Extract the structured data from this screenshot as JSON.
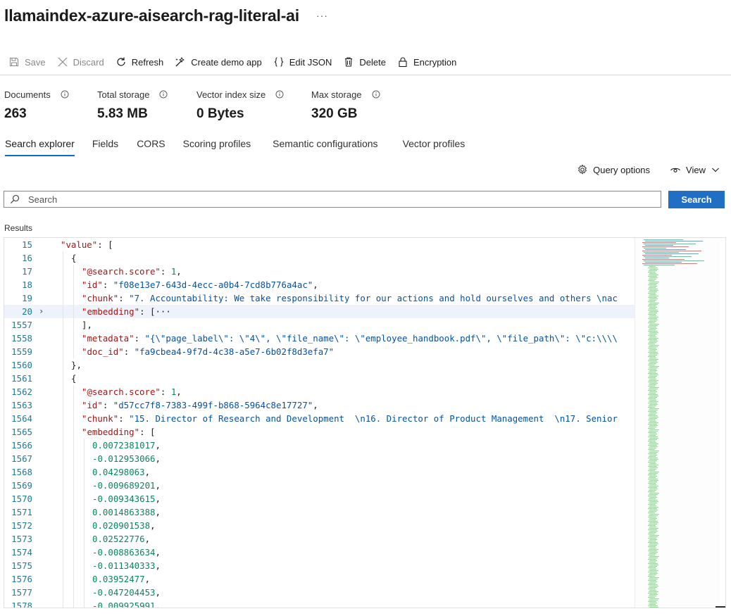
{
  "header": {
    "title": "llamaindex-azure-aisearch-rag-literal-ai",
    "more": "···"
  },
  "toolbar": {
    "save": "Save",
    "discard": "Discard",
    "refresh": "Refresh",
    "create_demo": "Create demo app",
    "edit_json": "Edit JSON",
    "delete": "Delete",
    "encryption": "Encryption"
  },
  "stats": [
    {
      "label": "Documents",
      "value": "263"
    },
    {
      "label": "Total storage",
      "value": "5.83 MB"
    },
    {
      "label": "Vector index size",
      "value": "0 Bytes"
    },
    {
      "label": "Max storage",
      "value": "320 GB"
    }
  ],
  "tabs": [
    "Search explorer",
    "Fields",
    "CORS",
    "Scoring profiles",
    "Semantic configurations",
    "Vector profiles"
  ],
  "active_tab": "Search explorer",
  "options": {
    "query_options": "Query options",
    "view": "View"
  },
  "search": {
    "placeholder": "Search",
    "button": "Search"
  },
  "results_label": "Results",
  "code_lines": [
    {
      "n": "15",
      "indent": 1,
      "segs": [
        [
          "k",
          "\"value\""
        ],
        [
          "p",
          ": ["
        ]
      ]
    },
    {
      "n": "16",
      "indent": 2,
      "segs": [
        [
          "p",
          "{"
        ]
      ]
    },
    {
      "n": "17",
      "indent": 3,
      "segs": [
        [
          "k",
          "\"@search.score\""
        ],
        [
          "p",
          ": "
        ],
        [
          "n",
          "1"
        ],
        [
          "p",
          ","
        ]
      ]
    },
    {
      "n": "18",
      "indent": 3,
      "segs": [
        [
          "k",
          "\"id\""
        ],
        [
          "p",
          ": "
        ],
        [
          "s",
          "\"f08e13e7-643d-4ecc-a0b4-7cd8b776a4ac\""
        ],
        [
          "p",
          ","
        ]
      ]
    },
    {
      "n": "19",
      "indent": 3,
      "segs": [
        [
          "k",
          "\"chunk\""
        ],
        [
          "p",
          ": "
        ],
        [
          "s",
          "\"7. Accountability: We take responsibility for our actions and hold ourselves and others \\nac"
        ]
      ]
    },
    {
      "n": "20",
      "indent": 3,
      "fold": "›",
      "hl": true,
      "segs": [
        [
          "k",
          "\"embedding\""
        ],
        [
          "p",
          ": [···"
        ]
      ]
    },
    {
      "n": "1557",
      "indent": 3,
      "segs": [
        [
          "p",
          "],"
        ]
      ]
    },
    {
      "n": "1558",
      "indent": 3,
      "segs": [
        [
          "k",
          "\"metadata\""
        ],
        [
          "p",
          ": "
        ],
        [
          "s",
          "\"{\\\"page_label\\\": \\\"4\\\", \\\"file_name\\\": \\\"employee_handbook.pdf\\\", \\\"file_path\\\": \\\"c:\\\\\\\\"
        ]
      ]
    },
    {
      "n": "1559",
      "indent": 3,
      "segs": [
        [
          "k",
          "\"doc_id\""
        ],
        [
          "p",
          ": "
        ],
        [
          "s",
          "\"fa9cbea4-9f7d-4c38-a5e7-6b02f8d3efa7\""
        ]
      ]
    },
    {
      "n": "1560",
      "indent": 2,
      "segs": [
        [
          "p",
          "},"
        ]
      ]
    },
    {
      "n": "1561",
      "indent": 2,
      "segs": [
        [
          "p",
          "{"
        ]
      ]
    },
    {
      "n": "1562",
      "indent": 3,
      "segs": [
        [
          "k",
          "\"@search.score\""
        ],
        [
          "p",
          ": "
        ],
        [
          "n",
          "1"
        ],
        [
          "p",
          ","
        ]
      ]
    },
    {
      "n": "1563",
      "indent": 3,
      "segs": [
        [
          "k",
          "\"id\""
        ],
        [
          "p",
          ": "
        ],
        [
          "s",
          "\"d57cc7f8-7383-499f-b868-5964c8e17727\""
        ],
        [
          "p",
          ","
        ]
      ]
    },
    {
      "n": "1564",
      "indent": 3,
      "segs": [
        [
          "k",
          "\"chunk\""
        ],
        [
          "p",
          ": "
        ],
        [
          "s",
          "\"15. Director of Research and Development  \\n16. Director of Product Management  \\n17. Senior"
        ]
      ]
    },
    {
      "n": "1565",
      "indent": 3,
      "segs": [
        [
          "k",
          "\"embedding\""
        ],
        [
          "p",
          ": ["
        ]
      ]
    },
    {
      "n": "1566",
      "indent": 4,
      "segs": [
        [
          "n",
          "0.0072381017"
        ],
        [
          "p",
          ","
        ]
      ]
    },
    {
      "n": "1567",
      "indent": 4,
      "segs": [
        [
          "n",
          "-0.012953066"
        ],
        [
          "p",
          ","
        ]
      ]
    },
    {
      "n": "1568",
      "indent": 4,
      "segs": [
        [
          "n",
          "0.04298063"
        ],
        [
          "p",
          ","
        ]
      ]
    },
    {
      "n": "1569",
      "indent": 4,
      "segs": [
        [
          "n",
          "-0.009689201"
        ],
        [
          "p",
          ","
        ]
      ]
    },
    {
      "n": "1570",
      "indent": 4,
      "segs": [
        [
          "n",
          "-0.009343615"
        ],
        [
          "p",
          ","
        ]
      ]
    },
    {
      "n": "1571",
      "indent": 4,
      "segs": [
        [
          "n",
          "0.0014863388"
        ],
        [
          "p",
          ","
        ]
      ]
    },
    {
      "n": "1572",
      "indent": 4,
      "segs": [
        [
          "n",
          "0.020901538"
        ],
        [
          "p",
          ","
        ]
      ]
    },
    {
      "n": "1573",
      "indent": 4,
      "segs": [
        [
          "n",
          "0.02522776"
        ],
        [
          "p",
          ","
        ]
      ]
    },
    {
      "n": "1574",
      "indent": 4,
      "segs": [
        [
          "n",
          "-0.008863634"
        ],
        [
          "p",
          ","
        ]
      ]
    },
    {
      "n": "1575",
      "indent": 4,
      "segs": [
        [
          "n",
          "-0.011340333"
        ],
        [
          "p",
          ","
        ]
      ]
    },
    {
      "n": "1576",
      "indent": 4,
      "segs": [
        [
          "n",
          "0.03952477"
        ],
        [
          "p",
          ","
        ]
      ]
    },
    {
      "n": "1577",
      "indent": 4,
      "segs": [
        [
          "n",
          "-0.047204453"
        ],
        [
          "p",
          ","
        ]
      ]
    },
    {
      "n": "1578",
      "indent": 4,
      "segs": [
        [
          "n",
          "-0.009925991"
        ],
        [
          "p",
          ","
        ]
      ]
    }
  ],
  "colors": {
    "accent": "#0f6cbd",
    "button": "#1f6fc4",
    "key": "#a31515",
    "string": "#0451a5",
    "number": "#098658",
    "line_number": "#237893"
  }
}
